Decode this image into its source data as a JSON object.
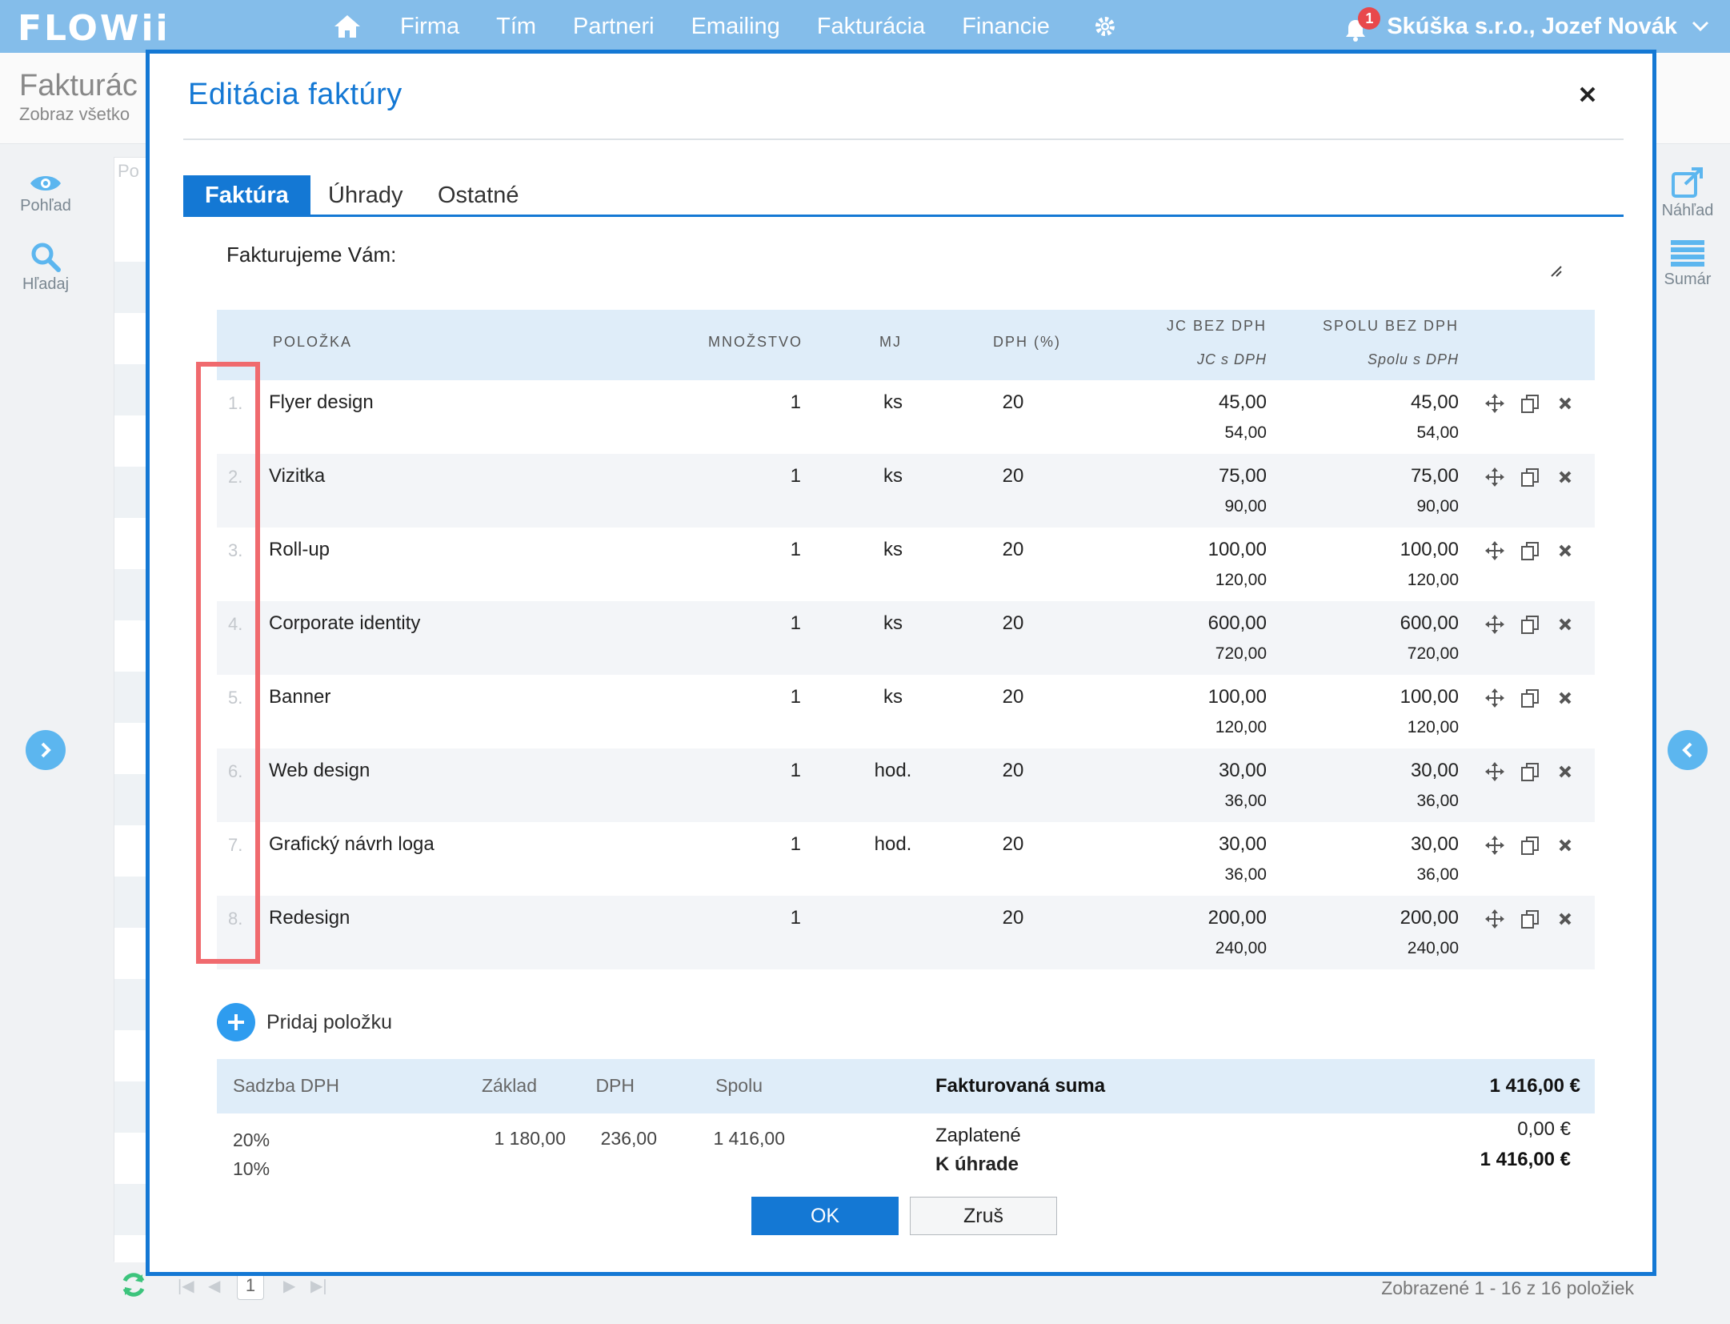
{
  "app": {
    "logo": "FLOWii",
    "nav": [
      "Firma",
      "Tím",
      "Partneri",
      "Emailing",
      "Fakturácia",
      "Financie"
    ],
    "notifications_count": "1",
    "user": "Skúška s.r.o., Jozef Novák"
  },
  "background": {
    "page_title": "Fakturác",
    "page_subtitle": "Zobraz všetko",
    "left_tools": [
      "Pohľad",
      "Hľadaj"
    ],
    "right_tools": [
      "Náhľad",
      "Sumár"
    ],
    "list_header_fragment": "Po",
    "pager_page": "1",
    "record_count": "Zobrazené 1 - 16 z 16 položiek"
  },
  "modal": {
    "title": "Editácia faktúry",
    "tabs": [
      "Faktúra",
      "Úhrady",
      "Ostatné"
    ],
    "active_tab": "Faktúra",
    "bill_to_label": "Fakturujeme Vám:",
    "columns": {
      "item": "POLOŽKA",
      "qty": "MNOŽSTVO",
      "unit": "MJ",
      "vat": "DPH (%)",
      "unit_price": "JC BEZ DPH",
      "unit_price_vat": "JC s DPH",
      "total": "SPOLU BEZ DPH",
      "total_vat": "Spolu s DPH"
    },
    "items": [
      {
        "num": "1.",
        "name": "Flyer design",
        "qty": "1",
        "unit": "ks",
        "vat": "20",
        "jc": "45,00",
        "jc_vat": "54,00",
        "total": "45,00",
        "total_vat": "54,00"
      },
      {
        "num": "2.",
        "name": "Vizitka",
        "qty": "1",
        "unit": "ks",
        "vat": "20",
        "jc": "75,00",
        "jc_vat": "90,00",
        "total": "75,00",
        "total_vat": "90,00"
      },
      {
        "num": "3.",
        "name": "Roll-up",
        "qty": "1",
        "unit": "ks",
        "vat": "20",
        "jc": "100,00",
        "jc_vat": "120,00",
        "total": "100,00",
        "total_vat": "120,00"
      },
      {
        "num": "4.",
        "name": "Corporate identity",
        "qty": "1",
        "unit": "ks",
        "vat": "20",
        "jc": "600,00",
        "jc_vat": "720,00",
        "total": "600,00",
        "total_vat": "720,00"
      },
      {
        "num": "5.",
        "name": "Banner",
        "qty": "1",
        "unit": "ks",
        "vat": "20",
        "jc": "100,00",
        "jc_vat": "120,00",
        "total": "100,00",
        "total_vat": "120,00"
      },
      {
        "num": "6.",
        "name": "Web design",
        "qty": "1",
        "unit": "hod.",
        "vat": "20",
        "jc": "30,00",
        "jc_vat": "36,00",
        "total": "30,00",
        "total_vat": "36,00"
      },
      {
        "num": "7.",
        "name": "Grafický návrh loga",
        "qty": "1",
        "unit": "hod.",
        "vat": "20",
        "jc": "30,00",
        "jc_vat": "36,00",
        "total": "30,00",
        "total_vat": "36,00"
      },
      {
        "num": "8.",
        "name": "Redesign",
        "qty": "1",
        "unit": "",
        "vat": "20",
        "jc": "200,00",
        "jc_vat": "240,00",
        "total": "200,00",
        "total_vat": "240,00"
      }
    ],
    "add_item_label": "Pridaj položku",
    "summary": {
      "headers": {
        "rate": "Sadzba DPH",
        "base": "Základ",
        "vat": "DPH",
        "total": "Spolu"
      },
      "rows": [
        {
          "rate": "20%",
          "base": "1 180,00",
          "vat": "236,00",
          "total": "1 416,00"
        },
        {
          "rate": "10%",
          "base": "",
          "vat": "",
          "total": ""
        }
      ],
      "invoiced_label": "Fakturovaná suma",
      "invoiced_value": "1 416,00 €",
      "paid_label": "Zaplatené",
      "paid_value": "0,00 €",
      "due_label": "K úhrade",
      "due_value": "1 416,00 €"
    },
    "ok_label": "OK",
    "cancel_label": "Zruš"
  },
  "colors": {
    "topbar": "#84bdea",
    "accent": "#1478d4",
    "table_header": "#dfedf9",
    "highlight": "#f06a6e"
  }
}
